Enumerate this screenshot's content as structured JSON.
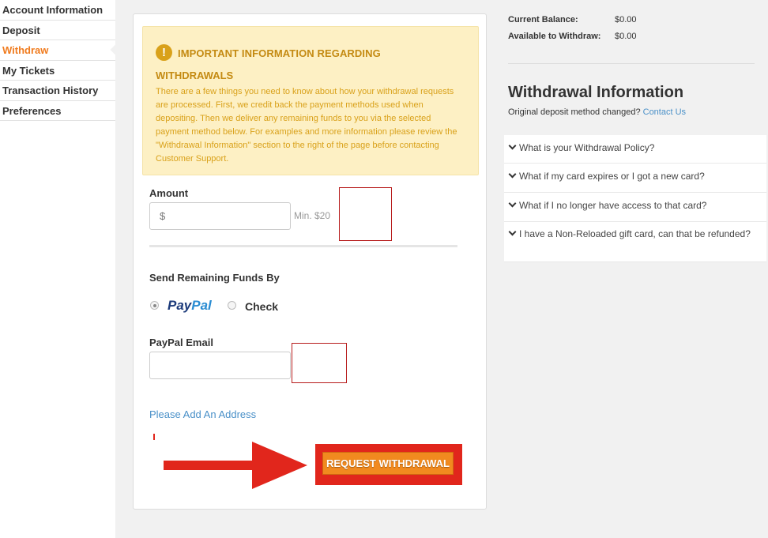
{
  "sidebar": {
    "items": [
      {
        "label": "Account Information"
      },
      {
        "label": "Deposit"
      },
      {
        "label": "Withdraw"
      },
      {
        "label": "My Tickets"
      },
      {
        "label": "Transaction History"
      },
      {
        "label": "Preferences"
      }
    ],
    "active_index": 2
  },
  "notice": {
    "icon": "exclamation-icon",
    "title_line1": "IMPORTANT INFORMATION REGARDING",
    "title_line2": "WITHDRAWALS",
    "body": "There are a few things you need to know about how your withdrawal requests are processed. First, we credit back the payment methods used when depositing. Then we deliver any remaining funds to you via the selected payment method below. For examples and more information please review the \"Withdrawal Information\" section to the right of the page before contacting Customer Support."
  },
  "form": {
    "amount_label": "Amount",
    "amount_placeholder": "$",
    "amount_hint": "Min. $20",
    "send_funds_label": "Send Remaining Funds By",
    "paypal_pay": "Pay",
    "paypal_pal": "Pal",
    "check_label": "Check",
    "selected_method": "paypal",
    "paypal_email_label": "PayPal Email",
    "paypal_email_value": "",
    "add_address_link": "Please Add An Address",
    "submit_label": "REQUEST WITHDRAWAL"
  },
  "balance": {
    "current_label": "Current Balance:",
    "current_value": "$0.00",
    "available_label": "Available to Withdraw:",
    "available_value": "$0.00"
  },
  "withdrawal_info": {
    "title": "Withdrawal Information",
    "subtitle": "Original deposit method changed?",
    "contact_link": "Contact Us",
    "faqs": [
      {
        "question": "What is your Withdrawal Policy?"
      },
      {
        "question": "What if my card expires or I got a new card?"
      },
      {
        "question": "What if I no longer have access to that card?"
      },
      {
        "question": "I have a Non-Reloaded gift card, can that be refunded?"
      }
    ]
  },
  "colors": {
    "accent_orange": "#f07b1e",
    "notice_bg": "#fdf0c4",
    "notice_text": "#d9a11a",
    "link_blue": "#4a90c8",
    "annotation_red": "#e1261c"
  }
}
